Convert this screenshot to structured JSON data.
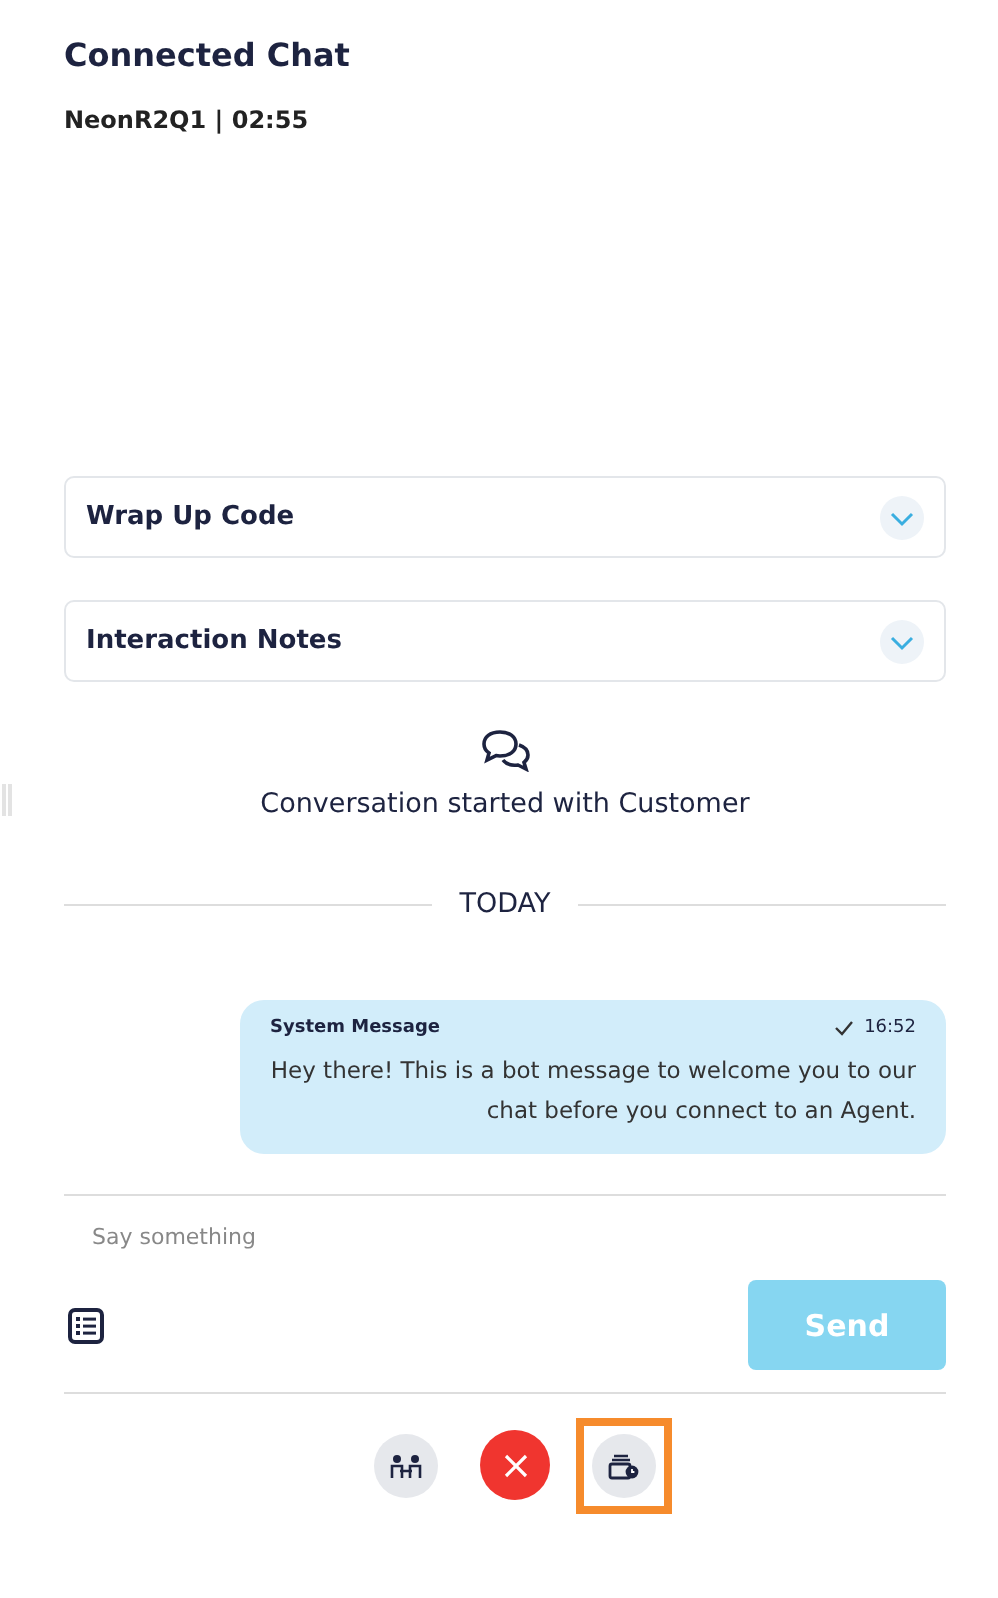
{
  "header": {
    "title": "Connected Chat",
    "subtitle": "NeonR2Q1 | 02:55"
  },
  "sections": [
    {
      "label": "Wrap Up Code",
      "expanded": false
    },
    {
      "label": "Interaction Notes",
      "expanded": false
    }
  ],
  "conversation_start": "Conversation started with Customer",
  "day_divider": "TODAY",
  "messages": [
    {
      "sender": "System Message",
      "time": "16:52",
      "delivered": true,
      "text": "Hey there! This is a bot message to welcome you to our chat before you connect to an Agent."
    }
  ],
  "composer": {
    "placeholder": "Say something",
    "send": "Send",
    "send_disabled": true
  },
  "actions": [
    {
      "kind": "transfer",
      "highlighted": false
    },
    {
      "kind": "end",
      "highlighted": false
    },
    {
      "kind": "hold",
      "highlighted": true
    }
  ]
}
